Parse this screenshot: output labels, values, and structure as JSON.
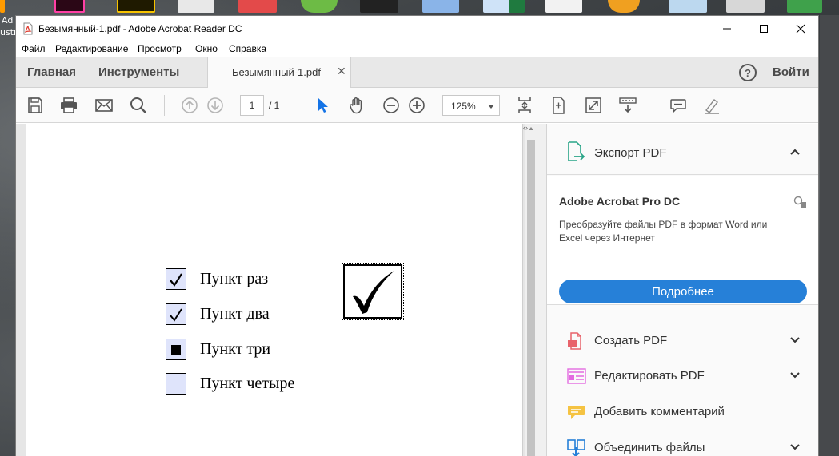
{
  "desktop": {
    "partial_labels": [
      "Ad",
      "ustr"
    ]
  },
  "window": {
    "title": "Безымянный-1.pdf - Adobe Acrobat Reader DC"
  },
  "menu": [
    "Файл",
    "Редактирование",
    "Просмотр",
    "Окно",
    "Справка"
  ],
  "tabs": {
    "home": "Главная",
    "tools": "Инструменты",
    "document": "Безымянный-1.pdf",
    "help": "?",
    "signin": "Войти"
  },
  "toolbar": {
    "page_current": "1",
    "page_total": "/ 1",
    "zoom": "125%"
  },
  "document": {
    "checkboxes": [
      {
        "label": "Пункт раз",
        "state": "checked"
      },
      {
        "label": "Пункт два",
        "state": "checked"
      },
      {
        "label": "Пункт три",
        "state": "square"
      },
      {
        "label": "Пункт четыре",
        "state": "empty"
      }
    ]
  },
  "right_pane": {
    "export": "Экспорт PDF",
    "promo_title": "Adobe Acrobat Pro DC",
    "promo_text": "Преобразуйте файлы PDF в формат Word или Excel через Интернет",
    "promo_button": "Подробнее",
    "tools": [
      {
        "label": "Создать PDF",
        "icon": "create-pdf-icon"
      },
      {
        "label": "Редактировать PDF",
        "icon": "edit-pdf-icon"
      },
      {
        "label": "Добавить комментарий",
        "icon": "comment-icon"
      },
      {
        "label": "Объединить файлы",
        "icon": "combine-files-icon"
      }
    ]
  },
  "colors": {
    "accent": "#2680d8",
    "acrobat_red": "#e03b2f",
    "field_fill": "#dfe4fb"
  }
}
